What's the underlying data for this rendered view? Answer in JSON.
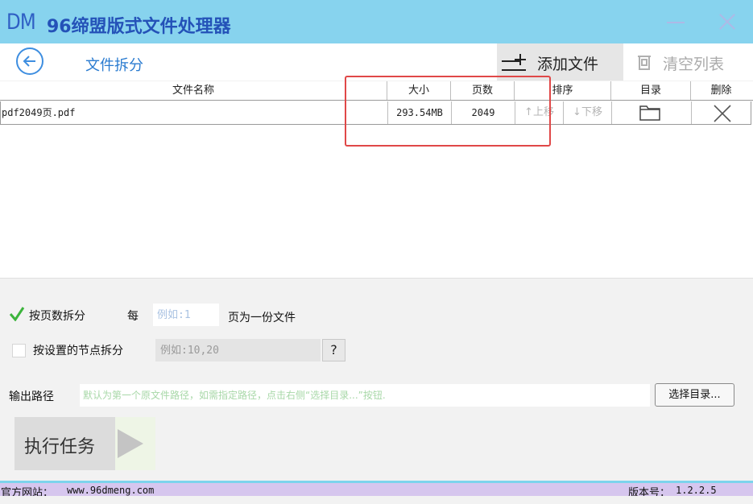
{
  "app": {
    "logo": "DM",
    "title": "96缔盟版式文件处理器"
  },
  "header": {
    "page_title": "文件拆分",
    "add_file_label": "添加文件",
    "clear_list_label": "清空列表"
  },
  "table": {
    "columns": {
      "name": "文件名称",
      "size": "大小",
      "pages": "页数",
      "sort": "排序",
      "directory": "目录",
      "delete": "删除"
    },
    "rows": [
      {
        "name": "pdf2049页.pdf",
        "size": "293.54MB",
        "pages": "2049",
        "move_up": "↑上移",
        "move_down": "↓下移"
      }
    ]
  },
  "options": {
    "split_by_pages": {
      "label": "按页数拆分",
      "checked": true,
      "prefix": "每",
      "placeholder": "例如:1",
      "suffix": "页为一份文件"
    },
    "split_by_nodes": {
      "label": "按设置的节点拆分",
      "checked": false,
      "placeholder": "例如:10,20",
      "help": "?"
    },
    "output": {
      "label": "输出路径",
      "placeholder": "默认为第一个原文件路径，如需指定路径，点击右侧“选择目录...”按钮.",
      "choose_label": "选择目录..."
    },
    "run_label": "执行任务"
  },
  "footer": {
    "site_label": "官方网站：",
    "site_url": "www.96dmeng.com",
    "version_label": "版本号：",
    "version": "1.2.2.5"
  },
  "colors": {
    "titlebar": "#87d3ee",
    "title_text": "#2452b8",
    "accent_blue": "#2a7bd0",
    "highlight_box": "#e04848",
    "check_green": "#3cb43c",
    "footer_band": "#d6c6ee"
  }
}
